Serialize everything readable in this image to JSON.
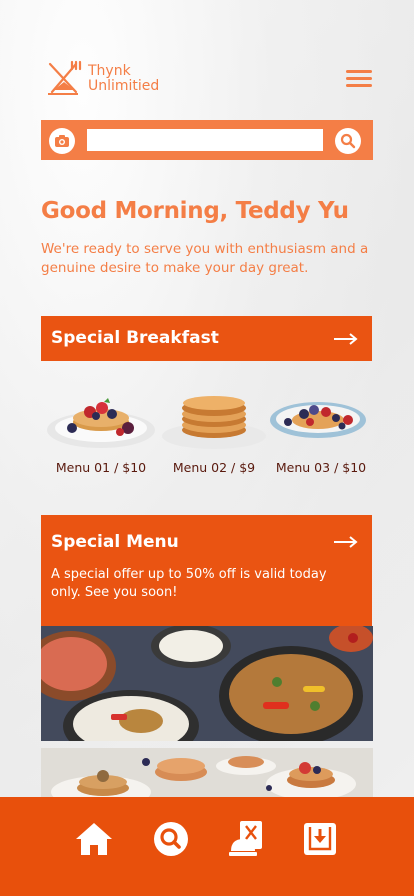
{
  "brand": {
    "line1": "Thynk",
    "line2": "Unlimitied"
  },
  "search": {
    "value": "",
    "placeholder": ""
  },
  "greeting": {
    "title": "Good Morning, Teddy Yu",
    "subtitle": "We're ready to serve you with enthusiasm and a genuine desire to make your day great."
  },
  "breakfast": {
    "title": "Special Breakfast",
    "items": [
      {
        "label": "Menu 01 / $10"
      },
      {
        "label": "Menu 02 / $9"
      },
      {
        "label": "Menu 03 / $10"
      }
    ]
  },
  "special_menu": {
    "title": "Special Menu",
    "description": "A special offer up to 50% off is valid today only. See you soon!"
  },
  "nav": {
    "items": [
      {
        "icon": "home-icon"
      },
      {
        "icon": "search-icon"
      },
      {
        "icon": "dining-icon"
      },
      {
        "icon": "download-box-icon"
      }
    ]
  },
  "colors": {
    "accent": "#f47e46",
    "primary": "#ea5412",
    "nav": "#e8500c",
    "caption": "#5a1a0e"
  }
}
